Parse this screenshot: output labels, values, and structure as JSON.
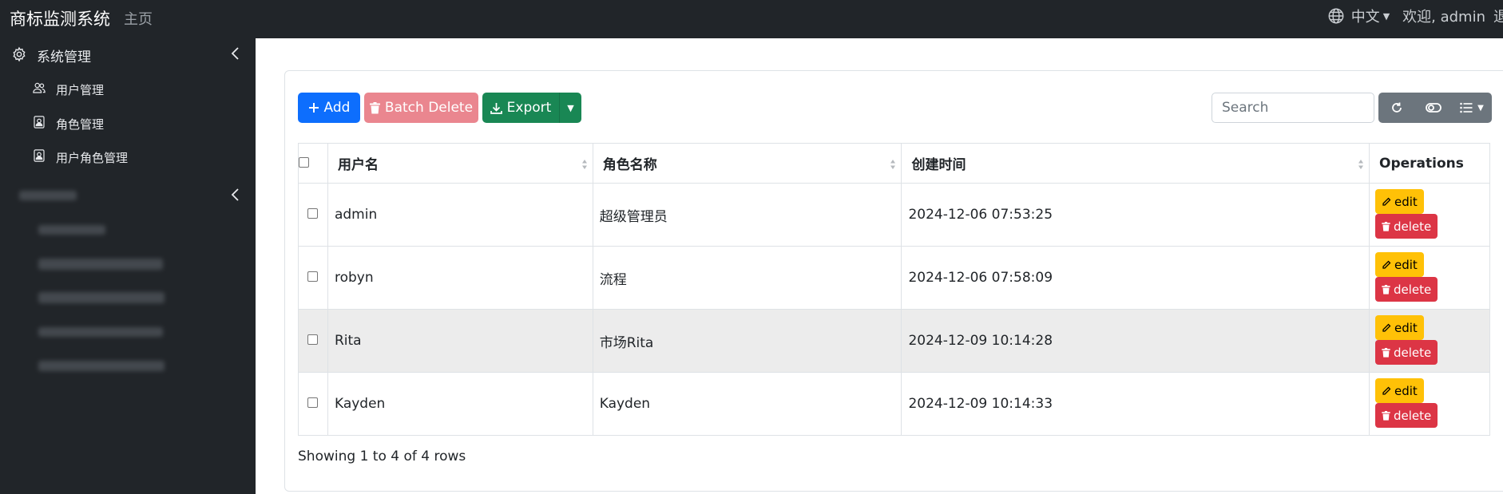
{
  "navbar": {
    "brand": "商标监测系统",
    "home": "主页",
    "language": "中文",
    "welcome": "欢迎, admin",
    "logout": "退"
  },
  "sidebar": {
    "groups": [
      {
        "label": "系统管理",
        "icon": "gear-icon",
        "items": [
          {
            "label": "用户管理",
            "icon": "users-icon"
          },
          {
            "label": "角色管理",
            "icon": "id-badge-icon"
          },
          {
            "label": "用户角色管理",
            "icon": "id-badge-icon"
          }
        ]
      }
    ]
  },
  "toolbar": {
    "add_label": "Add",
    "batch_delete_label": "Batch Delete",
    "export_label": "Export",
    "search_placeholder": "Search"
  },
  "table": {
    "columns": [
      "用户名",
      "角色名称",
      "创建时间",
      "Operations"
    ],
    "rows": [
      {
        "username": "admin",
        "role": "超级管理员",
        "created": "2024-12-06 07:53:25"
      },
      {
        "username": "robyn",
        "role": "流程",
        "created": "2024-12-06 07:58:09"
      },
      {
        "username": "Rita",
        "role": "市场Rita",
        "created": "2024-12-09 10:14:28"
      },
      {
        "username": "Kayden",
        "role": "Kayden",
        "created": "2024-12-09 10:14:33"
      }
    ],
    "edit_label": "edit",
    "delete_label": "delete",
    "footer": "Showing 1 to 4 of 4 rows"
  },
  "colors": {
    "navbar_bg": "#212529",
    "primary": "#0d6efd",
    "danger_light": "#ea868f",
    "success": "#198754",
    "secondary": "#6c757d",
    "warning": "#ffc107",
    "danger": "#dc3545"
  }
}
